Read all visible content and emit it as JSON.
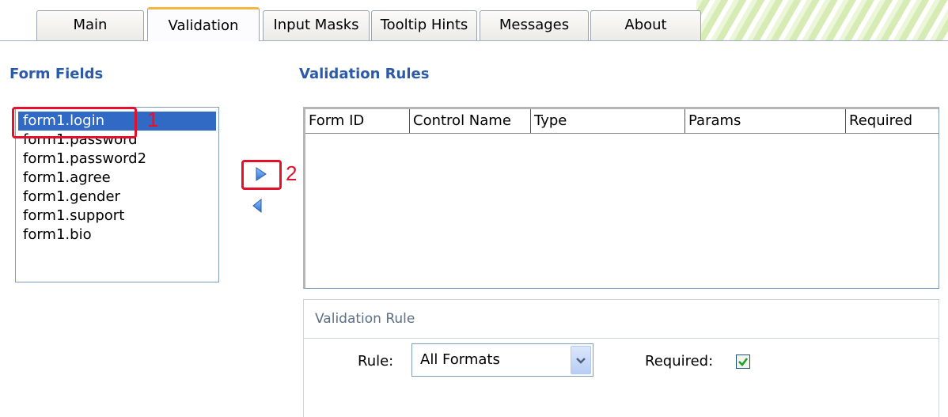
{
  "tabs": [
    {
      "label": "Main"
    },
    {
      "label": "Validation"
    },
    {
      "label": "Input Masks"
    },
    {
      "label": "Tooltip Hints"
    },
    {
      "label": "Messages"
    },
    {
      "label": "About"
    }
  ],
  "form_fields": {
    "title": "Form Fields",
    "items": [
      {
        "label": "form1.login"
      },
      {
        "label": "form1.password"
      },
      {
        "label": "form1.password2"
      },
      {
        "label": "form1.agree"
      },
      {
        "label": "form1.gender"
      },
      {
        "label": "form1.support"
      },
      {
        "label": "form1.bio"
      }
    ],
    "selected": "form1.login"
  },
  "annotations": {
    "one": "1",
    "two": "2",
    "color": "#e3112b"
  },
  "buttons": {
    "add_icon": "triangle-right-icon",
    "remove_icon": "triangle-left-icon"
  },
  "validation_rules": {
    "title": "Validation Rules",
    "columns": [
      {
        "label": "Form ID"
      },
      {
        "label": "Control Name"
      },
      {
        "label": "Type"
      },
      {
        "label": "Params"
      },
      {
        "label": "Required"
      }
    ]
  },
  "validation_rule": {
    "group_title": "Validation Rule",
    "rule_label": "Rule:",
    "rule_value": "All Formats",
    "required_label": "Required:",
    "required_checked": true
  },
  "colors": {
    "accent": "#2a5aa8",
    "selection": "#316ac5",
    "active_tab_top": "#f4b742"
  }
}
